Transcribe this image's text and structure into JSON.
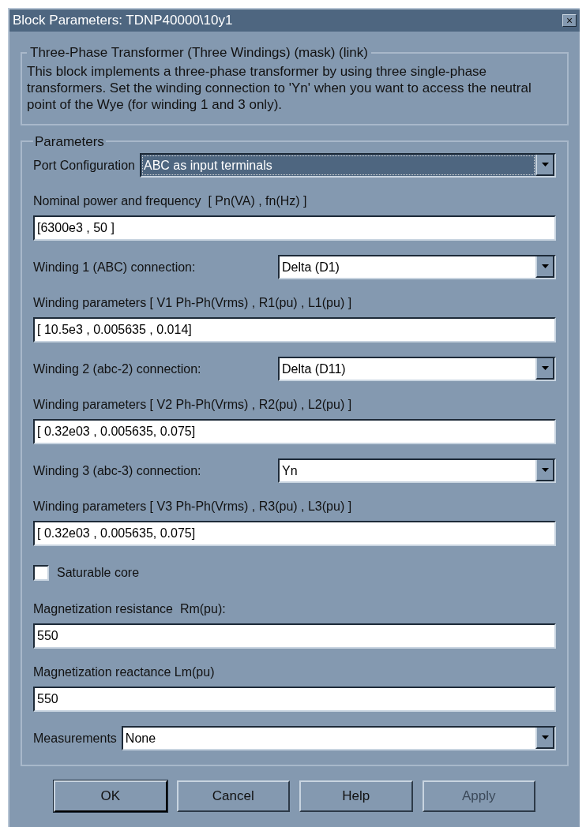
{
  "window": {
    "title": "Block Parameters: TDNP40000\\10y1",
    "close": "×"
  },
  "description": {
    "title": "Three-Phase Transformer (Three Windings) (mask) (link)",
    "text": "This block implements a three-phase transformer by using three single-phase transformers. Set the winding connection to 'Yn' when you want to access the neutral point of the Wye (for winding 1 and 3 only)."
  },
  "parameters": {
    "title": "Parameters",
    "fields": [
      {
        "kind": "dropdown",
        "label": "Port Configuration",
        "value": "ABC as input terminals",
        "focused": true
      },
      {
        "kind": "text",
        "label": "Nominal power and frequency  [ Pn(VA) , fn(Hz) ]",
        "value": "[6300e3 , 50 ]"
      },
      {
        "kind": "connection",
        "label": "Winding 1 (ABC) connection:",
        "value": "Delta (D1)",
        "focused": false
      },
      {
        "kind": "text",
        "label": "Winding parameters [ V1 Ph-Ph(Vrms) , R1(pu) , L1(pu) ]",
        "value": "[ 10.5e3 , 0.005635 , 0.014]"
      },
      {
        "kind": "connection",
        "label": "Winding 2 (abc-2) connection:",
        "value": "Delta (D11)",
        "focused": false
      },
      {
        "kind": "text",
        "label": "Winding parameters [ V2 Ph-Ph(Vrms) , R2(pu) , L2(pu) ]",
        "value": "[ 0.32e03 , 0.005635, 0.075]"
      },
      {
        "kind": "connection",
        "label": "Winding 3 (abc-3) connection:",
        "value": "Yn",
        "focused": false
      },
      {
        "kind": "text",
        "label": "Winding parameters [ V3 Ph-Ph(Vrms) , R3(pu) , L3(pu) ]",
        "value": "[ 0.32e03 , 0.005635, 0.075]"
      },
      {
        "kind": "checkbox",
        "label": "Saturable core",
        "checked": false
      },
      {
        "kind": "text",
        "label": "Magnetization resistance  Rm(pu):",
        "value": "550"
      },
      {
        "kind": "text",
        "label": "Magnetization reactance Lm(pu)",
        "value": "550"
      },
      {
        "kind": "dropdown",
        "label": "Measurements",
        "value": "None",
        "focused": false
      }
    ]
  },
  "buttons": [
    {
      "label": "OK",
      "default": true,
      "disabled": false
    },
    {
      "label": "Cancel",
      "default": false,
      "disabled": false
    },
    {
      "label": "Help",
      "default": false,
      "disabled": false
    },
    {
      "label": "Apply",
      "default": false,
      "disabled": true
    }
  ]
}
